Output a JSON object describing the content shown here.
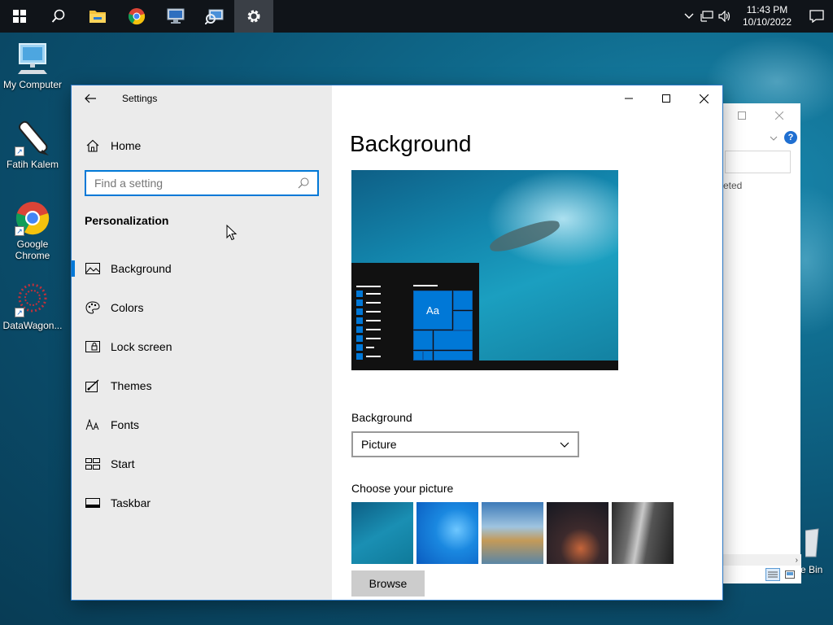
{
  "taskbar": {
    "clock_time": "11:43 PM",
    "clock_date": "10/10/2022",
    "pinned_icons": [
      "start-icon",
      "search-icon",
      "file-explorer-icon",
      "chrome-icon",
      "remote-desktop-icon",
      "network-icon",
      "settings-icon"
    ],
    "active_app": "settings-icon"
  },
  "desktop": {
    "icons": [
      {
        "label": "My Computer"
      },
      {
        "label": "Fatih Kalem"
      },
      {
        "label": "Google Chrome"
      },
      {
        "label": "DataWagon..."
      }
    ],
    "recycle_bin_partial": "e Bin"
  },
  "explorer_bg": {
    "partial_text": "eted"
  },
  "settings": {
    "app_title": "Settings",
    "home_label": "Home",
    "search_placeholder": "Find a setting",
    "section_title": "Personalization",
    "nav": [
      {
        "label": "Background",
        "icon": "picture-icon",
        "selected": true
      },
      {
        "label": "Colors",
        "icon": "palette-icon",
        "selected": false
      },
      {
        "label": "Lock screen",
        "icon": "lock-screen-icon",
        "selected": false
      },
      {
        "label": "Themes",
        "icon": "themes-icon",
        "selected": false
      },
      {
        "label": "Fonts",
        "icon": "fonts-icon",
        "selected": false
      },
      {
        "label": "Start",
        "icon": "start-layout-icon",
        "selected": false
      },
      {
        "label": "Taskbar",
        "icon": "taskbar-icon",
        "selected": false
      }
    ],
    "page_title": "Background",
    "preview_tile_text": "Aa",
    "background_label": "Background",
    "background_value": "Picture",
    "choose_label": "Choose your picture",
    "browse_label": "Browse",
    "accent_color": "#0078d7"
  }
}
